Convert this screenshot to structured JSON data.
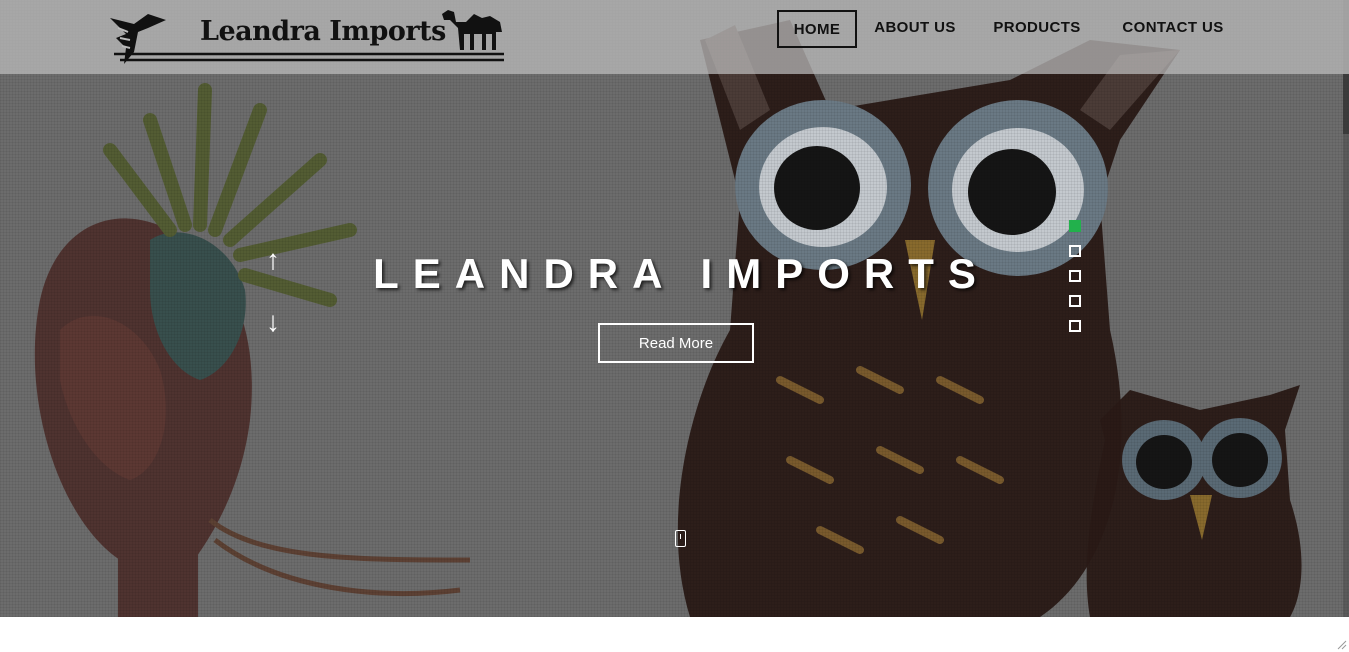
{
  "brand": {
    "name": "Leandra Imports"
  },
  "nav": {
    "items": [
      {
        "label": "HOME",
        "active": true
      },
      {
        "label": "ABOUT US",
        "active": false
      },
      {
        "label": "PRODUCTS",
        "active": false
      },
      {
        "label": "CONTACT US",
        "active": false
      }
    ]
  },
  "hero": {
    "title": "LEANDRA IMPORTS",
    "cta_label": "Read More",
    "slides": {
      "count": 5,
      "active_index": 0
    }
  },
  "icons": {
    "prev": "arrow-up-icon",
    "next": "arrow-down-icon",
    "scroll": "scroll-mouse-icon"
  },
  "colors": {
    "accent_active_dot": "#22b14c",
    "overlay": "#6a6a6a",
    "text_light": "#ffffff",
    "text_dark": "#111111"
  }
}
